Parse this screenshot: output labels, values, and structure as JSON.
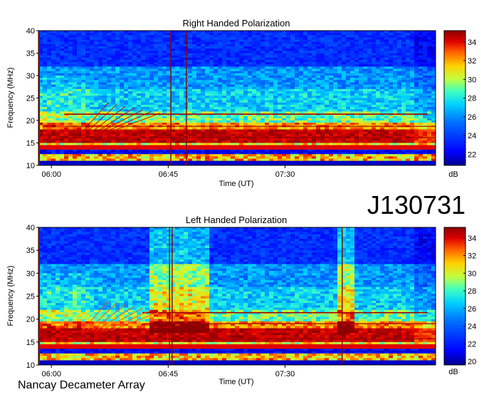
{
  "chart_data": [
    {
      "type": "heatmap",
      "title": "Right Handed Polarization",
      "xlabel": "Time (UT)",
      "ylabel": "Frequency (MHz)",
      "x_ticks": [
        "06:00",
        "06:45",
        "07:30"
      ],
      "x_tick_minutes": [
        360,
        405,
        450
      ],
      "x_range_minutes": [
        355,
        508
      ],
      "y_ticks": [
        10,
        15,
        20,
        25,
        30,
        35,
        40
      ],
      "ylim": [
        10,
        40
      ],
      "colorbar": {
        "label": "dB",
        "ticks": [
          22,
          24,
          26,
          28,
          30,
          32,
          34
        ],
        "range": [
          20.8,
          35.2
        ]
      }
    },
    {
      "type": "heatmap",
      "title": "Left Handed Polarization",
      "xlabel": "Time (UT)",
      "ylabel": "Frequency (MHz)",
      "x_ticks": [
        "06:00",
        "06:45",
        "07:30"
      ],
      "x_tick_minutes": [
        360,
        405,
        450
      ],
      "x_range_minutes": [
        355,
        508
      ],
      "y_ticks": [
        10,
        15,
        20,
        25,
        30,
        35,
        40
      ],
      "ylim": [
        10,
        40
      ],
      "colorbar": {
        "label": "dB",
        "ticks": [
          20,
          22,
          24,
          26,
          28,
          30,
          32,
          34
        ],
        "range": [
          19.6,
          35.2
        ]
      }
    }
  ],
  "event_id": "J130731",
  "footer": "Nancay Decameter Array",
  "colors": {
    "colormap": [
      "#00008f",
      "#0000ff",
      "#0070ff",
      "#00d0ff",
      "#40ffc0",
      "#c0ff40",
      "#ffd000",
      "#ff6000",
      "#e00000",
      "#8b0000"
    ]
  }
}
